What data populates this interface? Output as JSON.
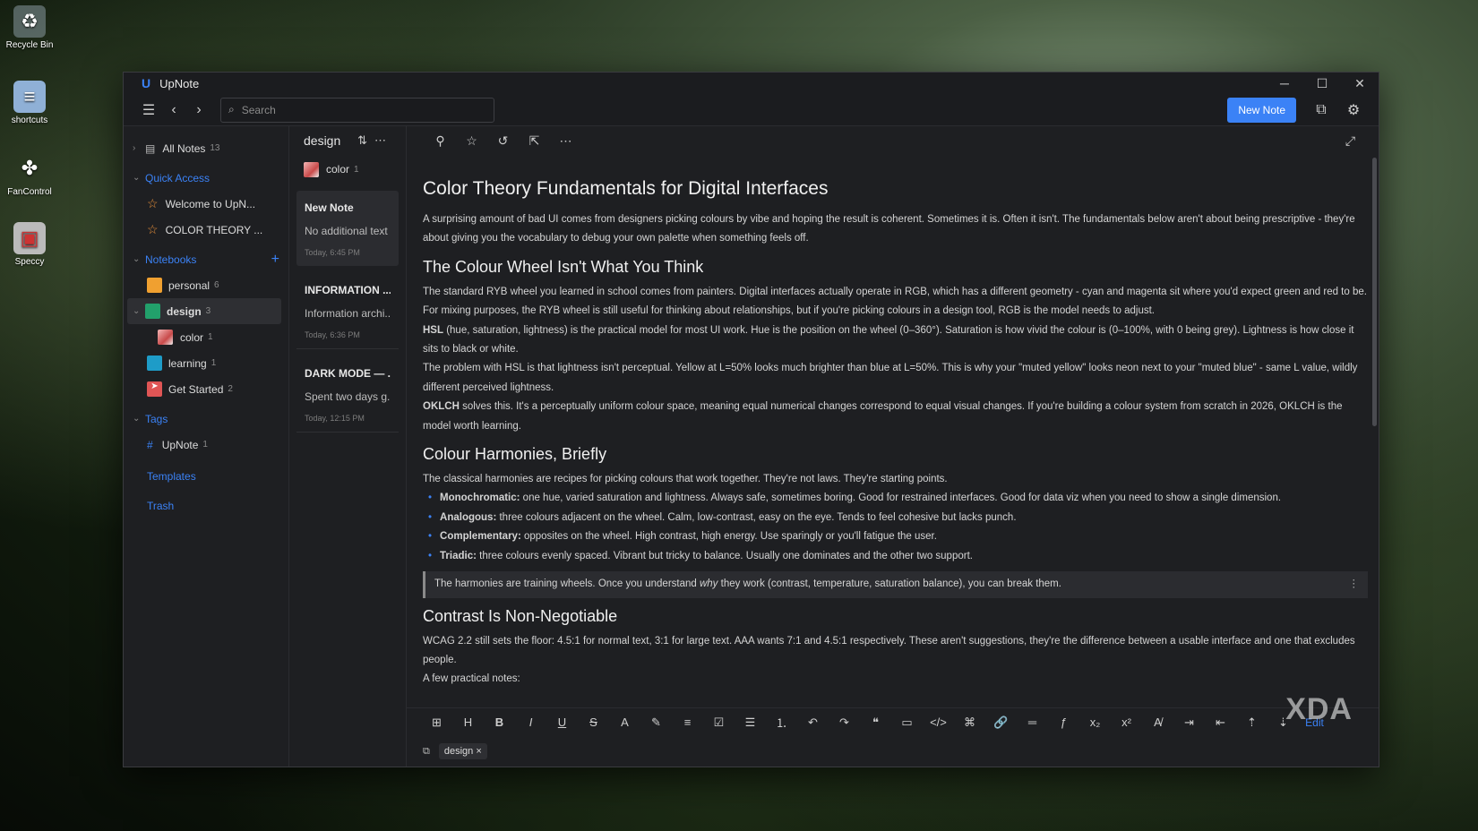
{
  "desktop": {
    "icons": [
      {
        "label": "Recycle Bin",
        "icon": "recycle-bin-icon"
      },
      {
        "label": "shortcuts",
        "icon": "folder-icon"
      },
      {
        "label": "FanControl",
        "icon": "fan-icon"
      },
      {
        "label": "Speccy",
        "icon": "speccy-icon"
      }
    ],
    "watermark": "XDA"
  },
  "window": {
    "title": "UpNote",
    "controls": {
      "minimize": "─",
      "maximize": "☐",
      "close": "✕"
    }
  },
  "toolbar": {
    "search_placeholder": "Search",
    "new_note_label": "New Note"
  },
  "sidebar": {
    "all_notes": {
      "label": "All Notes",
      "count": "13"
    },
    "quick_access": {
      "label": "Quick Access",
      "items": [
        "Welcome to UpN...",
        "COLOR THEORY ..."
      ]
    },
    "notebooks": {
      "label": "Notebooks",
      "items": [
        {
          "label": "personal",
          "count": "6",
          "color": "#f0a030"
        },
        {
          "label": "design",
          "count": "3",
          "color": "#22a06b"
        },
        {
          "label": "color",
          "count": "1",
          "color": "#e07070"
        },
        {
          "label": "learning",
          "count": "1",
          "color": "#1e9cc8"
        },
        {
          "label": "Get Started",
          "count": "2",
          "color": "#e05555"
        }
      ]
    },
    "tags": {
      "label": "Tags",
      "items": [
        {
          "label": "UpNote",
          "count": "1"
        }
      ]
    },
    "templates": "Templates",
    "trash": "Trash"
  },
  "notelist": {
    "title": "design",
    "sub": {
      "label": "color",
      "count": "1"
    },
    "notes": [
      {
        "title": "New Note",
        "preview": "No additional text",
        "date": "Today, 6:45 PM"
      },
      {
        "title": "INFORMATION ...",
        "preview": "Information archi...",
        "date": "Today, 6:36 PM"
      },
      {
        "title": "DARK MODE — ...",
        "preview": "Spent two days g...",
        "date": "Today, 12:15 PM"
      }
    ]
  },
  "editor": {
    "title": "Color Theory Fundamentals for Digital Interfaces",
    "intro": "A surprising amount of bad UI comes from designers picking colours by vibe and hoping the result is coherent. Sometimes it is. Often it isn't. The fundamentals below aren't about being prescriptive - they're about giving you the vocabulary to debug your own palette when something feels off.",
    "s1_heading": "The Colour Wheel Isn't What You Think",
    "s1_p1": "The standard RYB wheel you learned in school comes from painters. Digital interfaces actually operate in RGB, which has a different geometry - cyan and magenta sit where you'd expect green and red to be. For mixing purposes, the RYB wheel is still useful for thinking about relationships, but if you're picking colours in a design tool, RGB is the model needs to adjust.",
    "s1_p2_bold": "HSL",
    "s1_p2": " (hue, saturation, lightness) is the practical model for most UI work. Hue is the position on the wheel (0–360°). Saturation is how vivid the colour is (0–100%, with 0 being grey). Lightness is how close it sits to black or white.",
    "s1_p3": "The problem with HSL is that lightness isn't perceptual. Yellow at L=50% looks much brighter than blue at L=50%. This is why your \"muted yellow\" looks neon next to your \"muted blue\" - same L value, wildly different perceived lightness.",
    "s1_p4_bold": "OKLCH",
    "s1_p4": " solves this. It's a perceptually uniform colour space, meaning equal numerical changes correspond to equal visual changes. If you're building a colour system from scratch in 2026, OKLCH is the model worth learning.",
    "s2_heading": "Colour Harmonies, Briefly",
    "s2_p1": "The classical harmonies are recipes for picking colours that work together. They're not laws. They're starting points.",
    "s2_list": [
      {
        "bold": "Monochromatic:",
        "text": " one hue, varied saturation and lightness. Always safe, sometimes boring. Good for restrained interfaces. Good for data viz when you need to show a single dimension."
      },
      {
        "bold": "Analogous:",
        "text": " three colours adjacent on the wheel. Calm, low-contrast, easy on the eye. Tends to feel cohesive but lacks punch."
      },
      {
        "bold": "Complementary:",
        "text": " opposites on the wheel. High contrast, high energy. Use sparingly or you'll fatigue the user."
      },
      {
        "bold": "Triadic:",
        "text": " three colours evenly spaced. Vibrant but tricky to balance. Usually one dominates and the other two support."
      }
    ],
    "callout_before": "The harmonies are training wheels. Once you understand ",
    "callout_em": "why",
    "callout_after": " they work (contrast, temperature, saturation balance), you can break them.",
    "s3_heading": "Contrast Is Non-Negotiable",
    "s3_p1": "WCAG 2.2 still sets the floor: 4.5:1 for normal text, 3:1 for large text. AAA wants 7:1 and 4.5:1 respectively. These aren't suggestions, they're the difference between a usable interface and one that excludes people.",
    "s3_p2": "A few practical notes:",
    "edit_label": "Edit",
    "tag": "design"
  },
  "colors": {
    "accent": "#3b82f6",
    "window_bg": "#1e1f22"
  }
}
